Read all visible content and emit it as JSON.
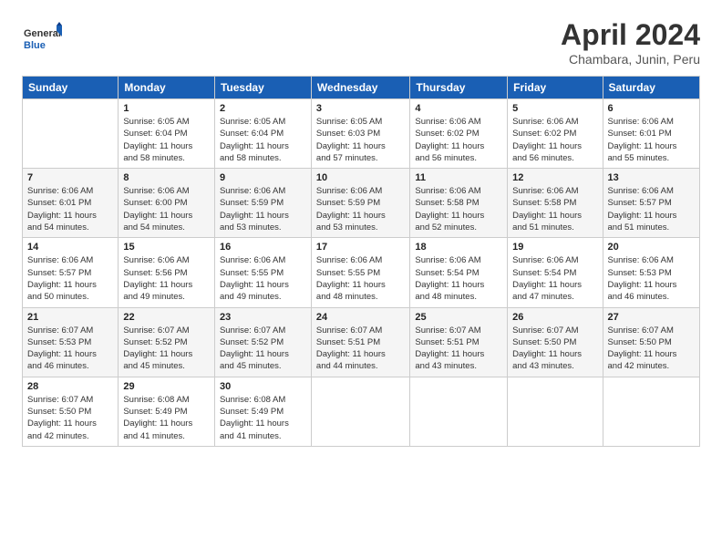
{
  "logo": {
    "general": "General",
    "blue": "Blue"
  },
  "header": {
    "title": "April 2024",
    "subtitle": "Chambara, Junin, Peru"
  },
  "weekdays": [
    "Sunday",
    "Monday",
    "Tuesday",
    "Wednesday",
    "Thursday",
    "Friday",
    "Saturday"
  ],
  "weeks": [
    [
      {
        "day": "",
        "info": ""
      },
      {
        "day": "1",
        "info": "Sunrise: 6:05 AM\nSunset: 6:04 PM\nDaylight: 11 hours\nand 58 minutes."
      },
      {
        "day": "2",
        "info": "Sunrise: 6:05 AM\nSunset: 6:04 PM\nDaylight: 11 hours\nand 58 minutes."
      },
      {
        "day": "3",
        "info": "Sunrise: 6:05 AM\nSunset: 6:03 PM\nDaylight: 11 hours\nand 57 minutes."
      },
      {
        "day": "4",
        "info": "Sunrise: 6:06 AM\nSunset: 6:02 PM\nDaylight: 11 hours\nand 56 minutes."
      },
      {
        "day": "5",
        "info": "Sunrise: 6:06 AM\nSunset: 6:02 PM\nDaylight: 11 hours\nand 56 minutes."
      },
      {
        "day": "6",
        "info": "Sunrise: 6:06 AM\nSunset: 6:01 PM\nDaylight: 11 hours\nand 55 minutes."
      }
    ],
    [
      {
        "day": "7",
        "info": ""
      },
      {
        "day": "8",
        "info": "Sunrise: 6:06 AM\nSunset: 6:00 PM\nDaylight: 11 hours\nand 54 minutes."
      },
      {
        "day": "9",
        "info": "Sunrise: 6:06 AM\nSunset: 5:59 PM\nDaylight: 11 hours\nand 53 minutes."
      },
      {
        "day": "10",
        "info": "Sunrise: 6:06 AM\nSunset: 5:59 PM\nDaylight: 11 hours\nand 53 minutes."
      },
      {
        "day": "11",
        "info": "Sunrise: 6:06 AM\nSunset: 5:58 PM\nDaylight: 11 hours\nand 52 minutes."
      },
      {
        "day": "12",
        "info": "Sunrise: 6:06 AM\nSunset: 5:58 PM\nDaylight: 11 hours\nand 51 minutes."
      },
      {
        "day": "13",
        "info": "Sunrise: 6:06 AM\nSunset: 5:57 PM\nDaylight: 11 hours\nand 51 minutes."
      }
    ],
    [
      {
        "day": "14",
        "info": ""
      },
      {
        "day": "15",
        "info": "Sunrise: 6:06 AM\nSunset: 5:56 PM\nDaylight: 11 hours\nand 49 minutes."
      },
      {
        "day": "16",
        "info": "Sunrise: 6:06 AM\nSunset: 5:55 PM\nDaylight: 11 hours\nand 49 minutes."
      },
      {
        "day": "17",
        "info": "Sunrise: 6:06 AM\nSunset: 5:55 PM\nDaylight: 11 hours\nand 48 minutes."
      },
      {
        "day": "18",
        "info": "Sunrise: 6:06 AM\nSunset: 5:54 PM\nDaylight: 11 hours\nand 48 minutes."
      },
      {
        "day": "19",
        "info": "Sunrise: 6:06 AM\nSunset: 5:54 PM\nDaylight: 11 hours\nand 47 minutes."
      },
      {
        "day": "20",
        "info": "Sunrise: 6:06 AM\nSunset: 5:53 PM\nDaylight: 11 hours\nand 46 minutes."
      }
    ],
    [
      {
        "day": "21",
        "info": ""
      },
      {
        "day": "22",
        "info": "Sunrise: 6:07 AM\nSunset: 5:52 PM\nDaylight: 11 hours\nand 45 minutes."
      },
      {
        "day": "23",
        "info": "Sunrise: 6:07 AM\nSunset: 5:52 PM\nDaylight: 11 hours\nand 45 minutes."
      },
      {
        "day": "24",
        "info": "Sunrise: 6:07 AM\nSunset: 5:51 PM\nDaylight: 11 hours\nand 44 minutes."
      },
      {
        "day": "25",
        "info": "Sunrise: 6:07 AM\nSunset: 5:51 PM\nDaylight: 11 hours\nand 43 minutes."
      },
      {
        "day": "26",
        "info": "Sunrise: 6:07 AM\nSunset: 5:50 PM\nDaylight: 11 hours\nand 43 minutes."
      },
      {
        "day": "27",
        "info": "Sunrise: 6:07 AM\nSunset: 5:50 PM\nDaylight: 11 hours\nand 42 minutes."
      }
    ],
    [
      {
        "day": "28",
        "info": "Sunrise: 6:07 AM\nSunset: 5:50 PM\nDaylight: 11 hours\nand 42 minutes."
      },
      {
        "day": "29",
        "info": "Sunrise: 6:08 AM\nSunset: 5:49 PM\nDaylight: 11 hours\nand 41 minutes."
      },
      {
        "day": "30",
        "info": "Sunrise: 6:08 AM\nSunset: 5:49 PM\nDaylight: 11 hours\nand 41 minutes."
      },
      {
        "day": "",
        "info": ""
      },
      {
        "day": "",
        "info": ""
      },
      {
        "day": "",
        "info": ""
      },
      {
        "day": "",
        "info": ""
      }
    ]
  ],
  "week1_day7_info": "Sunrise: 6:06 AM\nSunset: 6:01 PM\nDaylight: 11 hours\nand 54 minutes.",
  "week1_day14_info": "Sunrise: 6:06 AM\nSunset: 5:57 PM\nDaylight: 11 hours\nand 50 minutes.",
  "week1_day21_info": "Sunrise: 6:07 AM\nSunset: 5:53 PM\nDaylight: 11 hours\nand 46 minutes."
}
